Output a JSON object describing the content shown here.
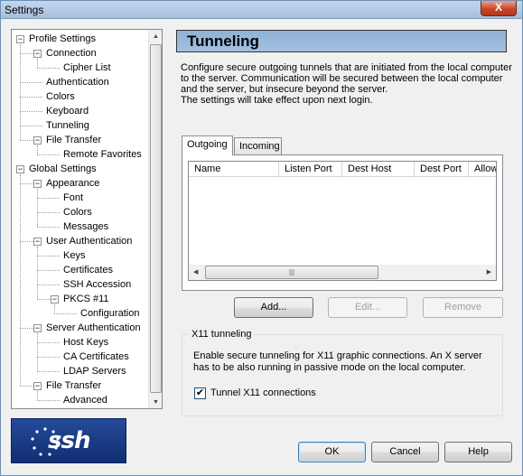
{
  "window": {
    "title": "Settings",
    "close_glyph": "X"
  },
  "tree": {
    "items": [
      {
        "label": "Profile Settings",
        "level": 0,
        "expander": "−"
      },
      {
        "label": "Connection",
        "level": 1,
        "expander": "−"
      },
      {
        "label": "Cipher List",
        "level": 2
      },
      {
        "label": "Authentication",
        "level": 1
      },
      {
        "label": "Colors",
        "level": 1
      },
      {
        "label": "Keyboard",
        "level": 1
      },
      {
        "label": "Tunneling",
        "level": 1,
        "selected": true
      },
      {
        "label": "File Transfer",
        "level": 1,
        "expander": "−"
      },
      {
        "label": "Remote Favorites",
        "level": 2
      },
      {
        "label": "Global Settings",
        "level": 0,
        "expander": "−"
      },
      {
        "label": "Appearance",
        "level": 1,
        "expander": "−"
      },
      {
        "label": "Font",
        "level": 2
      },
      {
        "label": "Colors",
        "level": 2
      },
      {
        "label": "Messages",
        "level": 2
      },
      {
        "label": "User Authentication",
        "level": 1,
        "expander": "−"
      },
      {
        "label": "Keys",
        "level": 2
      },
      {
        "label": "Certificates",
        "level": 2
      },
      {
        "label": "SSH Accession",
        "level": 2
      },
      {
        "label": "PKCS #11",
        "level": 2,
        "expander": "−"
      },
      {
        "label": "Configuration",
        "level": 3
      },
      {
        "label": "Server Authentication",
        "level": 1,
        "expander": "−"
      },
      {
        "label": "Host Keys",
        "level": 2
      },
      {
        "label": "CA Certificates",
        "level": 2
      },
      {
        "label": "LDAP Servers",
        "level": 2
      },
      {
        "label": "File Transfer",
        "level": 1,
        "expander": "−"
      },
      {
        "label": "Advanced",
        "level": 2
      }
    ]
  },
  "logo": {
    "text": "ssh"
  },
  "page": {
    "title": "Tunneling",
    "description_lines": [
      "Configure secure outgoing tunnels that are initiated from the local computer",
      "to the server. Communication will be secured between the local computer",
      "and the server, but insecure beyond the server.",
      "The settings will take effect upon next login."
    ]
  },
  "tabs": [
    {
      "label": "Outgoing",
      "active": true
    },
    {
      "label": "Incoming",
      "active": false
    }
  ],
  "table": {
    "columns": [
      "Name",
      "Listen Port",
      "Dest Host",
      "Dest Port",
      "Allow"
    ],
    "rows": []
  },
  "list_buttons": {
    "add": "Add...",
    "edit": "Edit...",
    "remove": "Remove"
  },
  "x11": {
    "legend": "X11 tunneling",
    "text_lines": [
      "Enable secure tunneling for X11 graphic connections. An X server",
      "has to be also running in passive mode on the local computer."
    ],
    "checkbox_label": "Tunnel X11 connections",
    "checked": true,
    "check_glyph": "✔"
  },
  "dialog_buttons": {
    "ok": "OK",
    "cancel": "Cancel",
    "help": "Help"
  }
}
